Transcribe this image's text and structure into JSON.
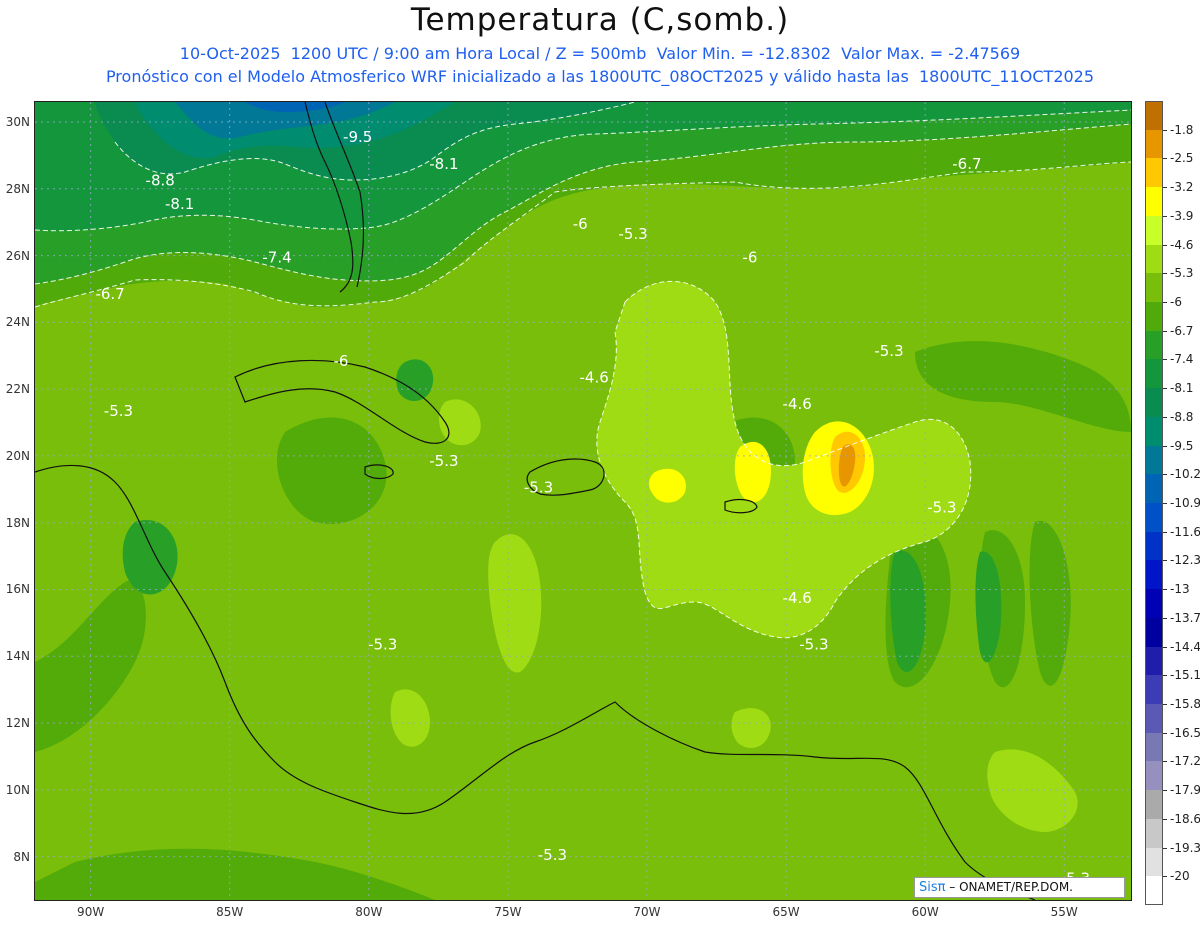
{
  "title": "Temperatura (C,somb.)",
  "subtitle1": "10-Oct-2025  1200 UTC / 9:00 am Hora Local / Z = 500mb  Valor Min. = -12.8302  Valor Max. = -2.47569",
  "subtitle2": "Pronóstico con el Modelo Atmosferico WRF inicializado a las 1800UTC_08OCT2025 y válido hasta las  1800UTC_11OCT2025",
  "lat_labels": [
    "30N",
    "28N",
    "26N",
    "24N",
    "22N",
    "20N",
    "18N",
    "16N",
    "14N",
    "12N",
    "10N",
    "8N"
  ],
  "lon_labels": [
    "90W",
    "85W",
    "80W",
    "75W",
    "70W",
    "65W",
    "60W",
    "55W"
  ],
  "contour_labels": [
    {
      "text": "-9.5",
      "lon": -80.4,
      "lat": 29.4
    },
    {
      "text": "-8.1",
      "lon": -77.3,
      "lat": 28.6
    },
    {
      "text": "-6.7",
      "lon": -58.5,
      "lat": 28.6
    },
    {
      "text": "-8.8",
      "lon": -87.5,
      "lat": 28.1
    },
    {
      "text": "-8.1",
      "lon": -86.8,
      "lat": 27.4
    },
    {
      "text": "-6",
      "lon": -72.4,
      "lat": 26.8
    },
    {
      "text": "-5.3",
      "lon": -70.5,
      "lat": 26.5
    },
    {
      "text": "-6",
      "lon": -66.3,
      "lat": 25.8
    },
    {
      "text": "-7.4",
      "lon": -83.3,
      "lat": 25.8
    },
    {
      "text": "-6.7",
      "lon": -89.3,
      "lat": 24.7
    },
    {
      "text": "-5.3",
      "lon": -61.3,
      "lat": 23.0
    },
    {
      "text": "-6",
      "lon": -81.0,
      "lat": 22.7
    },
    {
      "text": "-4.6",
      "lon": -71.9,
      "lat": 22.2
    },
    {
      "text": "-5.3",
      "lon": -89.0,
      "lat": 21.2
    },
    {
      "text": "-4.6",
      "lon": -64.6,
      "lat": 21.4
    },
    {
      "text": "-5.3",
      "lon": -77.3,
      "lat": 19.7
    },
    {
      "text": "-5.3",
      "lon": -73.9,
      "lat": 18.9
    },
    {
      "text": "-5.3",
      "lon": -59.4,
      "lat": 18.3
    },
    {
      "text": "-4.6",
      "lon": -64.6,
      "lat": 15.6
    },
    {
      "text": "-5.3",
      "lon": -79.5,
      "lat": 14.2
    },
    {
      "text": "-5.3",
      "lon": -64.0,
      "lat": 14.2
    },
    {
      "text": "-5.3",
      "lon": -73.4,
      "lat": 7.9
    },
    {
      "text": "-5.3",
      "lon": -54.6,
      "lat": 7.2
    }
  ],
  "colorbar": {
    "labels": [
      "-1.8",
      "-2.5",
      "-3.2",
      "-3.9",
      "-4.6",
      "-5.3",
      "-6",
      "-6.7",
      "-7.4",
      "-8.1",
      "-8.8",
      "-9.5",
      "-10.2",
      "-10.9",
      "-11.6",
      "-12.3",
      "-13",
      "-13.7",
      "-14.4",
      "-15.1",
      "-15.8",
      "-16.5",
      "-17.2",
      "-17.9",
      "-18.6",
      "-19.3",
      "-20"
    ],
    "colors": [
      "#c07000",
      "#e89600",
      "#ffc800",
      "#ffff00",
      "#c8ff28",
      "#a0dc14",
      "#78be0a",
      "#50aa0a",
      "#28a028",
      "#14963c",
      "#0a8c50",
      "#008c6e",
      "#007896",
      "#0064b4",
      "#0050c8",
      "#0032c8",
      "#0014c8",
      "#0000b4",
      "#0000a0",
      "#1e1eaa",
      "#3c3cb4",
      "#5a5ab4",
      "#7878b4",
      "#9690be",
      "#aaaaaa",
      "#c8c8c8",
      "#e1e1e1",
      "#ffffff"
    ]
  },
  "credit": {
    "brand": "Sisπ",
    "text": " – ONAMET/REP.DOM."
  }
}
